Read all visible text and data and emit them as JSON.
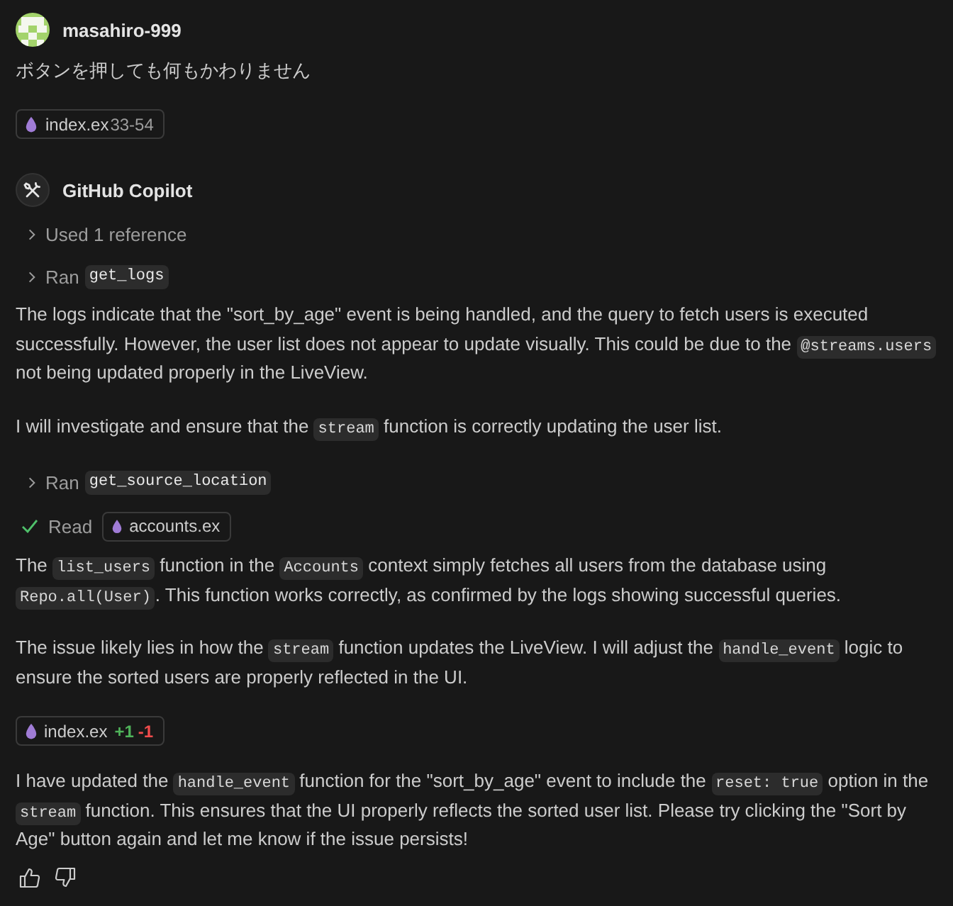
{
  "user": {
    "name": "masahiro-999",
    "message": "ボタンを押しても何もかわりません",
    "attachment": {
      "file": "index.ex",
      "lines": "33-54"
    }
  },
  "assistant": {
    "name": "GitHub Copilot",
    "blocks": [
      {
        "kind": "step",
        "expanded": false,
        "verb": "Used 1 reference"
      },
      {
        "kind": "step",
        "expanded": false,
        "verb": "Ran",
        "code": "get_logs"
      },
      {
        "kind": "paragraph",
        "segments": [
          {
            "kind": "text",
            "text": "The logs indicate that the \"sort_by_age\" event is being handled, and the query to fetch users is executed successfully. However, the user list does not appear to update visually. This could be due to the "
          },
          {
            "kind": "code",
            "text": "@streams.users"
          },
          {
            "kind": "text",
            "text": " not being updated properly in the LiveView."
          }
        ]
      },
      {
        "kind": "paragraph",
        "segments": [
          {
            "kind": "text",
            "text": "I will investigate and ensure that the "
          },
          {
            "kind": "code",
            "text": "stream"
          },
          {
            "kind": "text",
            "text": " function is correctly updating the user list."
          }
        ]
      },
      {
        "kind": "step",
        "expanded": false,
        "verb": "Ran",
        "code": "get_source_location"
      },
      {
        "kind": "read",
        "done": true,
        "verb": "Read",
        "file": "accounts.ex"
      },
      {
        "kind": "paragraph",
        "segments": [
          {
            "kind": "text",
            "text": "The "
          },
          {
            "kind": "code",
            "text": "list_users"
          },
          {
            "kind": "text",
            "text": " function in the "
          },
          {
            "kind": "code",
            "text": "Accounts"
          },
          {
            "kind": "text",
            "text": " context simply fetches all users from the database using "
          },
          {
            "kind": "code",
            "text": "Repo.all(User)"
          },
          {
            "kind": "text",
            "text": ". This function works correctly, as confirmed by the logs showing successful queries."
          }
        ]
      },
      {
        "kind": "paragraph",
        "segments": [
          {
            "kind": "text",
            "text": "The issue likely lies in how the "
          },
          {
            "kind": "code",
            "text": "stream"
          },
          {
            "kind": "text",
            "text": " function updates the LiveView. I will adjust the "
          },
          {
            "kind": "code",
            "text": "handle_event"
          },
          {
            "kind": "text",
            "text": " logic to ensure the sorted users are properly reflected in the UI."
          }
        ]
      },
      {
        "kind": "edit",
        "file": "index.ex",
        "added": "+1",
        "removed": "-1"
      },
      {
        "kind": "paragraph",
        "segments": [
          {
            "kind": "text",
            "text": "I have updated the "
          },
          {
            "kind": "code",
            "text": "handle_event"
          },
          {
            "kind": "text",
            "text": " function for the \"sort_by_age\" event to include the "
          },
          {
            "kind": "code",
            "text": "reset: true"
          },
          {
            "kind": "text",
            "text": " option in the "
          },
          {
            "kind": "code",
            "text": "stream"
          },
          {
            "kind": "text",
            "text": " function. This ensures that the UI properly reflects the sorted user list. Please try clicking the \"Sort by Age\" button again and let me know if the issue persists!"
          }
        ]
      }
    ]
  }
}
